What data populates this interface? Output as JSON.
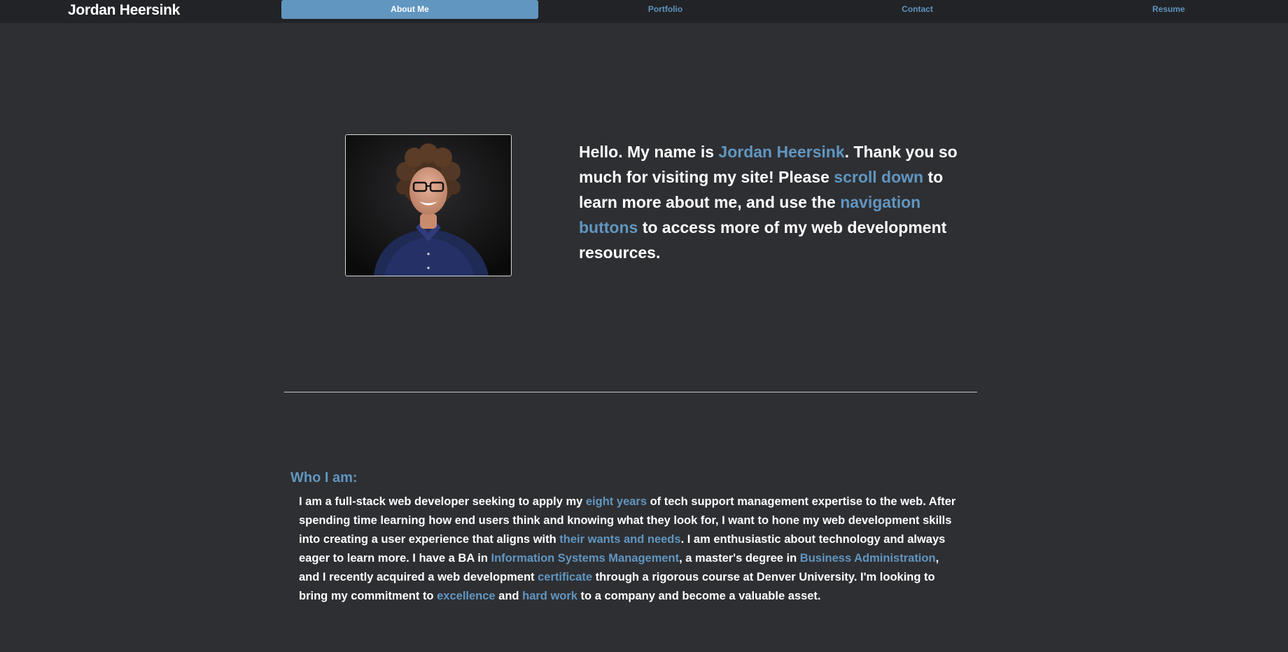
{
  "header": {
    "brand": "Jordan Heersink",
    "nav": [
      {
        "label": "About Me",
        "active": true
      },
      {
        "label": "Portfolio",
        "active": false
      },
      {
        "label": "Contact",
        "active": false
      },
      {
        "label": "Resume",
        "active": false
      }
    ]
  },
  "hero": {
    "portrait_alt": "portrait-photo",
    "intro": {
      "p1": "Hello. My name is ",
      "name": "Jordan Heersink",
      "p2": ". Thank you so much for visiting my site! Please ",
      "scroll": "scroll down",
      "p3": " to learn more about me, and use the ",
      "nav_buttons": "navigation buttons",
      "p4": " to access more of my web development resources."
    }
  },
  "about": {
    "title": "Who I am:",
    "t1": "I am a full-stack web developer seeking to apply my ",
    "h1": "eight years",
    "t2": " of tech support management expertise to the web. After spending time learning how end users think and knowing what they look for, I want to hone my web development skills into creating a user experience that aligns with ",
    "h2": "their wants and needs",
    "t3": ". I am enthusiastic about technology and always eager to learn more. I have a BA in ",
    "h3": "Information Systems Management",
    "t4": ", a master's degree in ",
    "h4": "Business Administration",
    "t5": ", and I recently acquired a web development ",
    "h5": "certificate",
    "t6": " through a rigorous course at Denver University. I'm looking to bring my commitment to ",
    "h6": "excellence",
    "t7": " and ",
    "h7": "hard work",
    "t8": " to a company and become a valuable asset."
  },
  "colors": {
    "background": "#2e2f33",
    "navbar": "#222326",
    "accent": "#6196c0",
    "text": "#ffffff"
  }
}
